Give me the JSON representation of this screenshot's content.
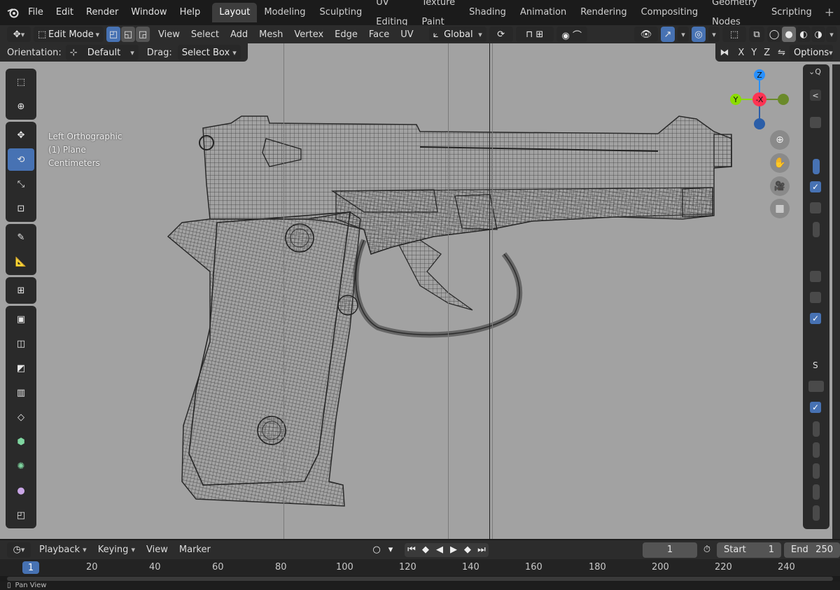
{
  "menu": [
    "File",
    "Edit",
    "Render",
    "Window",
    "Help"
  ],
  "workspaces": [
    "Layout",
    "Modeling",
    "Sculpting",
    "UV Editing",
    "Texture Paint",
    "Shading",
    "Animation",
    "Rendering",
    "Compositing",
    "Geometry Nodes",
    "Scripting"
  ],
  "active_workspace": "Layout",
  "header": {
    "mode": "Edit Mode",
    "items": [
      "View",
      "Select",
      "Add",
      "Mesh",
      "Vertex",
      "Edge",
      "Face",
      "UV"
    ],
    "transform_orientation": "Global"
  },
  "toolrow": {
    "orientation_label": "Orientation:",
    "orientation_value": "Default",
    "drag_label": "Drag:",
    "drag_value": "Select Box",
    "axes": [
      "X",
      "Y",
      "Z"
    ],
    "options_label": "Options"
  },
  "viewport": {
    "view_name": "Left Orthographic",
    "object": "(1) Plane",
    "units": "Centimeters"
  },
  "gizmo": {
    "z": "Z",
    "y": "Y",
    "x": "-X"
  },
  "timeline": {
    "items": [
      "Playback",
      "Keying",
      "View",
      "Marker"
    ],
    "current_frame": "1",
    "start_label": "Start",
    "start_value": "1",
    "end_label": "End",
    "end_value": "250"
  },
  "ruler": {
    "current": "1",
    "ticks": [
      "20",
      "40",
      "60",
      "80",
      "100",
      "120",
      "140",
      "160",
      "180",
      "200",
      "220",
      "240"
    ]
  },
  "status": {
    "text": "Pan View"
  },
  "side_panel": {
    "s_label": "S"
  },
  "colors": {
    "accent": "#4772b3",
    "viewport_bg": "#a2a2a2",
    "x_axis": "#ff3352",
    "y_axis": "#8bdc00",
    "z_axis": "#2890ff"
  }
}
